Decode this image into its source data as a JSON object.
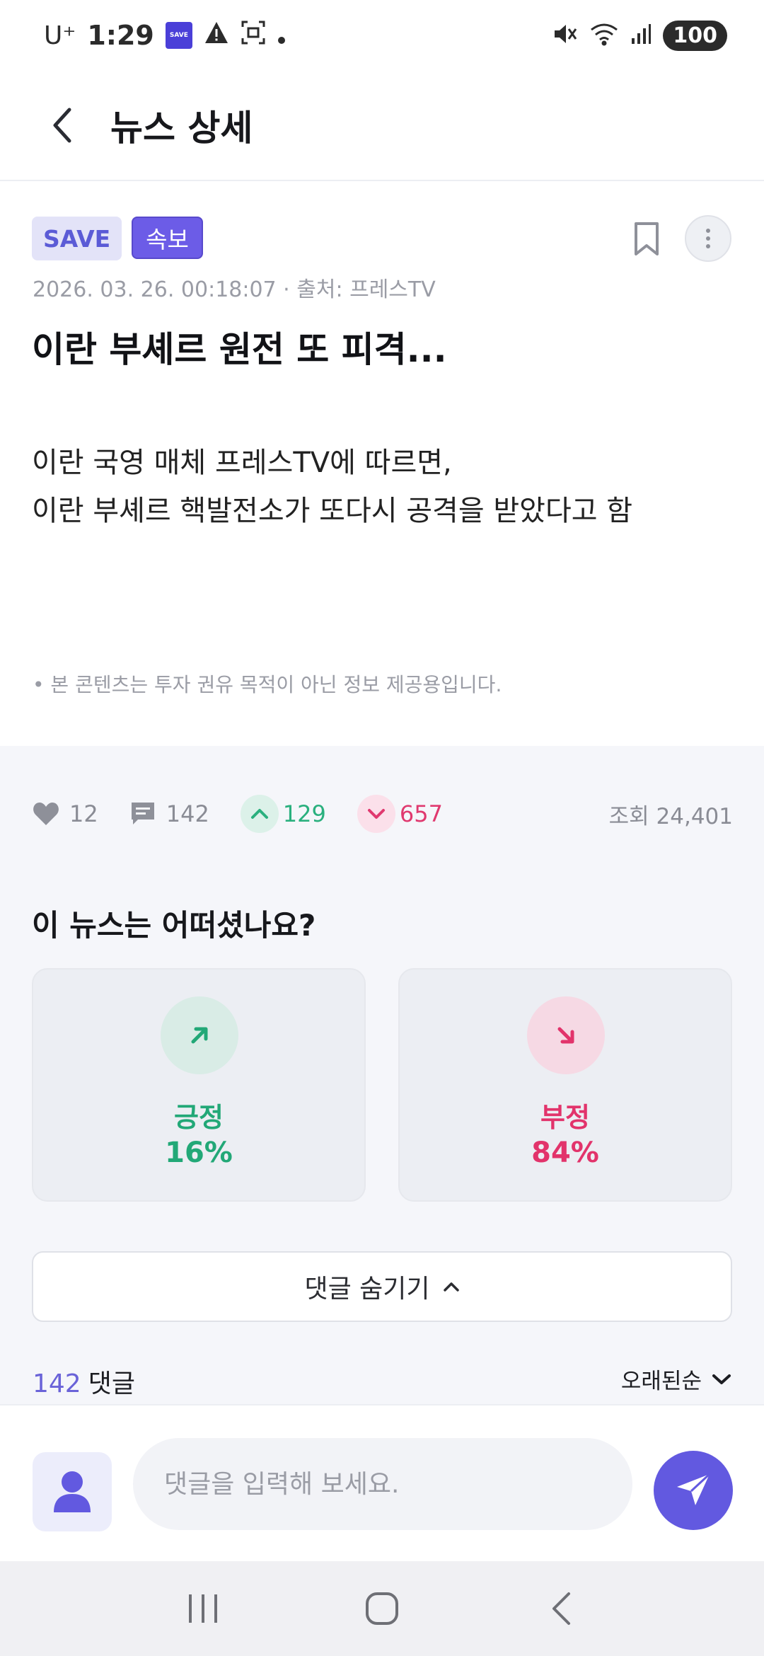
{
  "status_bar": {
    "carrier": "U⁺",
    "time": "1:29",
    "save_badge": "SAVE",
    "battery": "100"
  },
  "header": {
    "title": "뉴스 상세"
  },
  "article": {
    "badges": {
      "save": "SAVE",
      "breaking": "속보"
    },
    "meta": "2026. 03. 26. 00:18:07 · 출처: 프레스TV",
    "headline": "이란 부셰르 원전 또 피격...",
    "body_line1": "이란 국영 매체 프레스TV에 따르면,",
    "body_line2": "이란 부셰르 핵발전소가 또다시 공격을 받았다고 함",
    "disclaimer": "•   본 콘텐츠는 투자 권유 목적이 아닌 정보 제공용입니다."
  },
  "stats": {
    "likes": "12",
    "comments": "142",
    "up_votes": "129",
    "down_votes": "657",
    "views": "조회 24,401"
  },
  "sentiment": {
    "question": "이 뉴스는 어떠셨나요?",
    "positive": {
      "label": "긍정",
      "percent": "16%"
    },
    "negative": {
      "label": "부정",
      "percent": "84%"
    }
  },
  "comments": {
    "toggle_label": "댓글 숨기기",
    "count": "142",
    "count_suffix": "댓글",
    "sort_label": "오래된순"
  },
  "input": {
    "placeholder": "댓글을 입력해 보세요."
  },
  "colors": {
    "accent": "#6259e0",
    "positive": "#22a877",
    "negative": "#e2336b"
  }
}
